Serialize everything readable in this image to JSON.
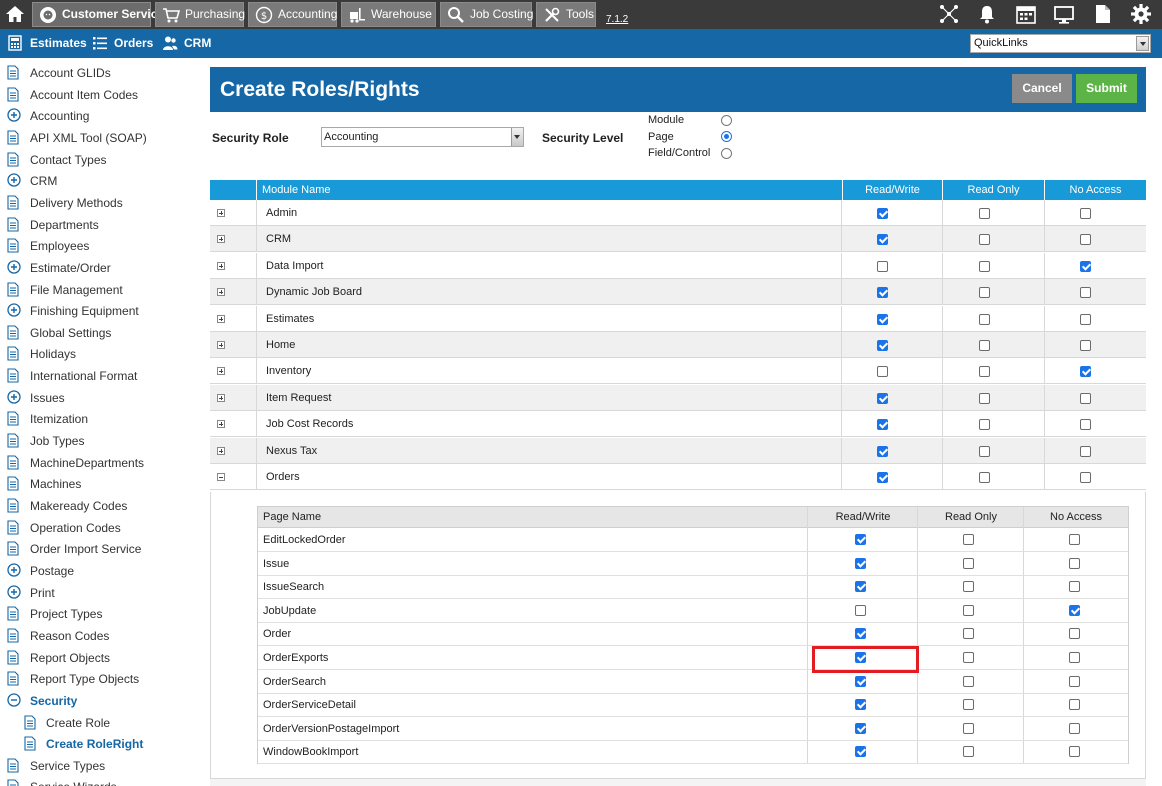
{
  "topnav": {
    "tabs": [
      {
        "label": "Customer Service",
        "icon": "customer-service-icon",
        "active": true
      },
      {
        "label": "Purchasing",
        "icon": "cart-icon"
      },
      {
        "label": "Accounting",
        "icon": "dollar-icon"
      },
      {
        "label": "Warehouse",
        "icon": "forklift-icon"
      },
      {
        "label": "Job Costing",
        "icon": "magnifier-icon"
      },
      {
        "label": "Tools",
        "icon": "tools-icon"
      }
    ],
    "version": "7.1.2",
    "right_icons": [
      "network-icon",
      "bell-icon",
      "calendar-icon",
      "monitor-icon",
      "document-icon",
      "gear-icon"
    ]
  },
  "subnav": {
    "items": [
      {
        "label": "Estimates",
        "icon": "calculator-icon"
      },
      {
        "label": "Orders",
        "icon": "list-icon"
      },
      {
        "label": "CRM",
        "icon": "users-icon"
      }
    ],
    "quicklinks": "QuickLinks"
  },
  "sidebar": {
    "items": [
      {
        "label": "Account GLIDs",
        "type": "doc"
      },
      {
        "label": "Account Item Codes",
        "type": "doc"
      },
      {
        "label": "Accounting",
        "type": "plus"
      },
      {
        "label": "API XML Tool (SOAP)",
        "type": "doc"
      },
      {
        "label": "Contact Types",
        "type": "doc"
      },
      {
        "label": "CRM",
        "type": "plus"
      },
      {
        "label": "Delivery Methods",
        "type": "doc"
      },
      {
        "label": "Departments",
        "type": "doc"
      },
      {
        "label": "Employees",
        "type": "doc"
      },
      {
        "label": "Estimate/Order",
        "type": "plus"
      },
      {
        "label": "File Management",
        "type": "doc"
      },
      {
        "label": "Finishing Equipment",
        "type": "plus"
      },
      {
        "label": "Global Settings",
        "type": "doc"
      },
      {
        "label": "Holidays",
        "type": "doc"
      },
      {
        "label": "International Format",
        "type": "doc"
      },
      {
        "label": "Issues",
        "type": "plus"
      },
      {
        "label": "Itemization",
        "type": "doc"
      },
      {
        "label": "Job Types",
        "type": "doc"
      },
      {
        "label": "MachineDepartments",
        "type": "doc"
      },
      {
        "label": "Machines",
        "type": "doc"
      },
      {
        "label": "Makeready Codes",
        "type": "doc"
      },
      {
        "label": "Operation Codes",
        "type": "doc"
      },
      {
        "label": "Order Import Service",
        "type": "doc"
      },
      {
        "label": "Postage",
        "type": "plus"
      },
      {
        "label": "Print",
        "type": "plus"
      },
      {
        "label": "Project Types",
        "type": "doc"
      },
      {
        "label": "Reason Codes",
        "type": "doc"
      },
      {
        "label": "Report Objects",
        "type": "doc"
      },
      {
        "label": "Report Type Objects",
        "type": "doc"
      },
      {
        "label": "Security",
        "type": "minus",
        "bold": true
      },
      {
        "label": "Create Role",
        "type": "doc",
        "child": true
      },
      {
        "label": "Create RoleRight",
        "type": "doc",
        "child": true,
        "bold": true
      },
      {
        "label": "Service Types",
        "type": "doc"
      },
      {
        "label": "Service Wizards",
        "type": "doc"
      }
    ]
  },
  "main": {
    "title": "Create Roles/Rights",
    "cancel_label": "Cancel",
    "submit_label": "Submit",
    "security_role_label": "Security Role",
    "security_role_value": "Accounting",
    "security_level_label": "Security Level",
    "levels": [
      {
        "label": "Module",
        "selected": false
      },
      {
        "label": "Page",
        "selected": true
      },
      {
        "label": "Field/Control",
        "selected": false
      }
    ],
    "module_table": {
      "headers": [
        "Module Name",
        "Read/Write",
        "Read Only",
        "No Access"
      ],
      "rows": [
        {
          "name": "Admin",
          "rw": true,
          "ro": false,
          "na": false
        },
        {
          "name": "CRM",
          "rw": true,
          "ro": false,
          "na": false
        },
        {
          "name": "Data Import",
          "rw": false,
          "ro": false,
          "na": true
        },
        {
          "name": "Dynamic Job Board",
          "rw": true,
          "ro": false,
          "na": false
        },
        {
          "name": "Estimates",
          "rw": true,
          "ro": false,
          "na": false
        },
        {
          "name": "Home",
          "rw": true,
          "ro": false,
          "na": false
        },
        {
          "name": "Inventory",
          "rw": false,
          "ro": false,
          "na": true
        },
        {
          "name": "Item Request",
          "rw": true,
          "ro": false,
          "na": false
        },
        {
          "name": "Job Cost Records",
          "rw": true,
          "ro": false,
          "na": false
        },
        {
          "name": "Nexus Tax",
          "rw": true,
          "ro": false,
          "na": false
        },
        {
          "name": "Orders",
          "rw": true,
          "ro": false,
          "na": false,
          "expanded": true
        }
      ]
    },
    "page_table": {
      "headers": [
        "Page Name",
        "Read/Write",
        "Read Only",
        "No Access"
      ],
      "rows": [
        {
          "name": "EditLockedOrder",
          "rw": true,
          "ro": false,
          "na": false
        },
        {
          "name": "Issue",
          "rw": true,
          "ro": false,
          "na": false
        },
        {
          "name": "IssueSearch",
          "rw": true,
          "ro": false,
          "na": false
        },
        {
          "name": "JobUpdate",
          "rw": false,
          "ro": false,
          "na": true
        },
        {
          "name": "Order",
          "rw": true,
          "ro": false,
          "na": false
        },
        {
          "name": "OrderExports",
          "rw": true,
          "ro": false,
          "na": false,
          "highlighted": true
        },
        {
          "name": "OrderSearch",
          "rw": true,
          "ro": false,
          "na": false
        },
        {
          "name": "OrderServiceDetail",
          "rw": true,
          "ro": false,
          "na": false
        },
        {
          "name": "OrderVersionPostageImport",
          "rw": true,
          "ro": false,
          "na": false
        },
        {
          "name": "WindowBookImport",
          "rw": true,
          "ro": false,
          "na": false
        }
      ]
    }
  },
  "colors": {
    "primary": "#1567a6",
    "table_header": "#189ad9",
    "submit": "#5cb346",
    "cancel": "#8a8a8a",
    "highlight": "#e31b23",
    "check": "#1a73e8"
  }
}
